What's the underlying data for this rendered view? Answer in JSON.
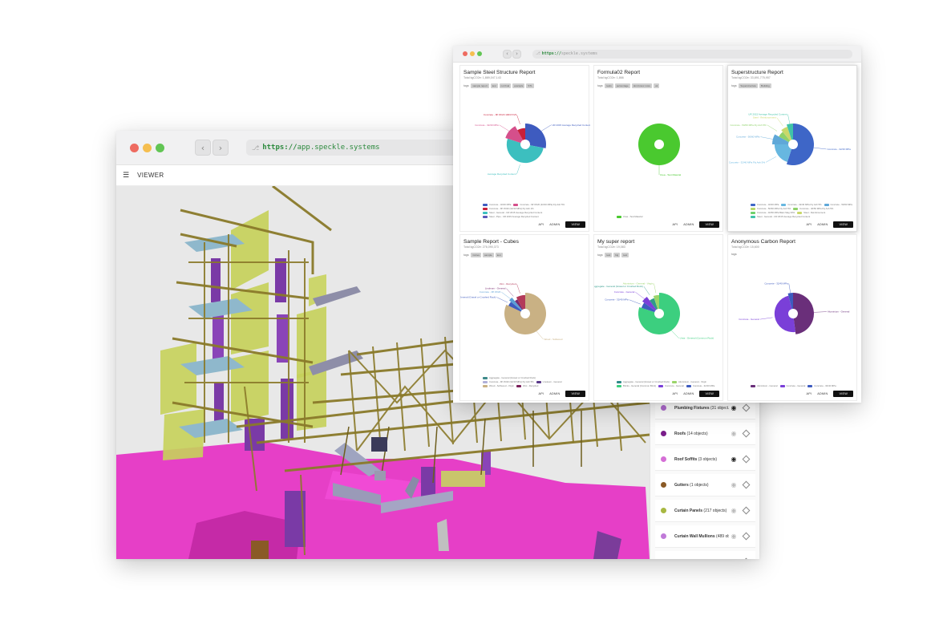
{
  "viewer_window": {
    "url_scheme": "https://",
    "url_host": "app.speckle.systems",
    "toolbar_label": "VIEWER",
    "categories": [
      {
        "name": "Plumbing Fixtures",
        "count": "(31 object...",
        "color": "#b06bd0",
        "visible": true
      },
      {
        "name": "Roofs",
        "count": "(14 objects)",
        "color": "#7a1f8a",
        "visible": false
      },
      {
        "name": "Roof Soffits",
        "count": "(3 objects)",
        "color": "#d56fd6",
        "visible": true
      },
      {
        "name": "Gutters",
        "count": "(1 objects)",
        "color": "#8a5a26",
        "visible": false
      },
      {
        "name": "Curtain Panels",
        "count": "(217 objects)",
        "color": "#a8b842",
        "visible": false
      },
      {
        "name": "Curtain Wall Mullions",
        "count": "(489 obj...",
        "color": "#c07ad8",
        "visible": false
      },
      {
        "name": "",
        "count": "",
        "color": "#e8804a",
        "visible": true
      }
    ]
  },
  "reports_window": {
    "url_scheme": "https://",
    "url_host": "speckle.systems",
    "buttons": {
      "api": "API",
      "admin": "ADMIN",
      "view": "VIEW"
    },
    "tags_label": "tags:",
    "cards": [
      {
        "title": "Sample Steel Structure Report",
        "subtitle": "Total kgCO2e: 1,889,047,143",
        "tags": [
          "sample report",
          "test",
          "not final",
          "example",
          "STL"
        ],
        "highlight": false,
        "slices": [
          {
            "label": "UR 2015 Average Recycled Content",
            "value": 28,
            "color": "#3e5bbf"
          },
          {
            "label": "Average Recycled Content",
            "value": 52,
            "color": "#3cbfbf"
          },
          {
            "label": "Concrete - 32/40 MPa",
            "value": 12,
            "color": "#d54f8b"
          },
          {
            "label": "Concrete - Mf 15/20 100/15 Mf",
            "value": 8,
            "color": "#c91f3a"
          }
        ],
        "legend": [
          {
            "label": "Concrete - 32/40 MPa",
            "color": "#3e5bbf"
          },
          {
            "label": "Concrete - Mf 15/20 (32/40 MPa) Fly Ash 5%",
            "color": "#d54f8b"
          },
          {
            "label": "Concrete - Mf 15/20 (32/40 MPa) Fly Ash 1%",
            "color": "#c91f3a"
          },
          {
            "label": "Steel - General - UR 2015 Average Recycled Content",
            "color": "#3cbfbf"
          },
          {
            "label": "Steel - Pipe - UR 2015 Average Recycled Content",
            "color": "#5b57b8"
          }
        ]
      },
      {
        "title": "Formula02 Report",
        "subtitle": "Total kgCO2e: 1,866",
        "tags": [
          "tests",
          "percentage",
          "dont know more",
          "ok"
        ],
        "highlight": false,
        "slices": [
          {
            "label": "Urea - Test Material",
            "value": 100,
            "color": "#4ac92f"
          }
        ],
        "legend": [
          {
            "label": "Urea - Test Material",
            "color": "#4ac92f"
          }
        ]
      },
      {
        "title": "Superstructure Report",
        "subtitle": "Total kgCO2e: 33,891,775,957",
        "tags": [
          "Superstructure",
          "Building"
        ],
        "highlight": true,
        "slices": [
          {
            "label": "Concrete - 32/40 MPa",
            "value": 55,
            "color": "#3e66c7"
          },
          {
            "label": "Concrete - 32/40 MPa Fly Ash 5%",
            "value": 20,
            "color": "#67b7e0"
          },
          {
            "label": "Concrete - 50/60 MPa",
            "value": 8,
            "color": "#5fa8d8"
          },
          {
            "label": "Concrete - 50/60 MPa Fly Ash 5%",
            "value": 6,
            "color": "#8fd16a"
          },
          {
            "label": "Steel - Reinforcement",
            "value": 6,
            "color": "#c9d86a"
          },
          {
            "label": "UR 2015 Average Recycled Content",
            "value": 5,
            "color": "#40c3a8"
          }
        ],
        "legend": [
          {
            "label": "Concrete - 32/40 MPa",
            "color": "#3e66c7"
          },
          {
            "label": "Concrete - 32/40 MPa Fly Ash 5%",
            "color": "#67b7e0"
          },
          {
            "label": "Concrete - 50/60 MPa",
            "color": "#5fa8d8"
          },
          {
            "label": "Concrete - 50/60 MPa Fly Ash 5%",
            "color": "#b9d86a"
          },
          {
            "label": "Concrete - 40/50 MPa Fly Ash 5%",
            "color": "#8fd16a"
          },
          {
            "label": "Concrete - 40/50 MPa Blast Slag 30%",
            "color": "#6ed06b"
          },
          {
            "label": "Steel - Reinforcement",
            "color": "#c9d86a"
          },
          {
            "label": "Steel - General - UR 2015 Average Recycled Content",
            "color": "#40c3a8"
          }
        ]
      },
      {
        "title": "Sample Report - Cubes",
        "subtitle": "Total kgCO2e: 276,090,373",
        "tags": [
          "Cubes",
          "sample",
          "test"
        ],
        "highlight": false,
        "slices": [
          {
            "label": "Wood - Softwood",
            "value": 82,
            "color": "#c9b184"
          },
          {
            "label": "Aggregate - General (Gravel or Crushed Rock)",
            "value": 4,
            "color": "#3e5bbf"
          },
          {
            "label": "Concrete - Mf 15/20",
            "value": 3,
            "color": "#5b9fd5"
          },
          {
            "label": "Linoleum - General",
            "value": 3,
            "color": "#7a2a70"
          },
          {
            "label": "Zinc - Recycled",
            "value": 8,
            "color": "#b33a5a"
          }
        ],
        "legend": [
          {
            "label": "Aggregate - General (Gravel or Crushed Rock)",
            "color": "#3e8a8a"
          },
          {
            "label": "Concrete - Mf 15/20 (32/40 MPa) Fly Ash 5%",
            "color": "#b0b0d8"
          },
          {
            "label": "Linoleum - General",
            "color": "#5b3a8a"
          },
          {
            "label": "Wood - Softwood - Virgin",
            "color": "#c9b184"
          },
          {
            "label": "Zinc - Recycled",
            "color": "#7a1f5a"
          }
        ]
      },
      {
        "title": "My super report",
        "subtitle": "Total kgCO2e: 19,083",
        "tags": [
          "test",
          "big",
          "test"
        ],
        "highlight": false,
        "slices": [
          {
            "label": "Urea - General (Common Rock)",
            "value": 80,
            "color": "#3ccf7f"
          },
          {
            "label": "Concrete - 32/40 MPa",
            "value": 5,
            "color": "#3e5bbf"
          },
          {
            "label": "Concrete - General",
            "value": 5,
            "color": "#7a3fd8"
          },
          {
            "label": "Aggregate - General (Gravel or Crushed Rock)",
            "value": 5,
            "color": "#2f9a8a"
          },
          {
            "label": "Aluminium - General - Virgin",
            "value": 5,
            "color": "#9bd56a"
          }
        ],
        "legend": [
          {
            "label": "Aggregate - General (Gravel or Crushed Rock)",
            "color": "#2f8a8a"
          },
          {
            "label": "Aluminium - General - Virgin",
            "color": "#9bd56a"
          },
          {
            "label": "Bricks - General (Common Brick)",
            "color": "#3ccf7f"
          },
          {
            "label": "Concrete - General",
            "color": "#7a3fd8"
          },
          {
            "label": "Concrete - 32/40 MPa",
            "color": "#3e5bbf"
          }
        ]
      },
      {
        "title": "Anonymous Carbon Report",
        "subtitle": "Total kgCO2e: 15,600",
        "tags": [],
        "highlight": false,
        "slices": [
          {
            "label": "Aluminium - General",
            "value": 48,
            "color": "#6a2f7a"
          },
          {
            "label": "Concrete - General",
            "value": 48,
            "color": "#7a3fd8"
          },
          {
            "label": "Concrete - 32/40 MPa",
            "value": 4,
            "color": "#3e5bbf"
          }
        ],
        "legend": [
          {
            "label": "Aluminium - General",
            "color": "#6a2f7a"
          },
          {
            "label": "Concrete - General",
            "color": "#7a3fd8"
          },
          {
            "label": "Concrete - 32/40 MPa",
            "color": "#3e5bbf"
          }
        ]
      }
    ]
  }
}
